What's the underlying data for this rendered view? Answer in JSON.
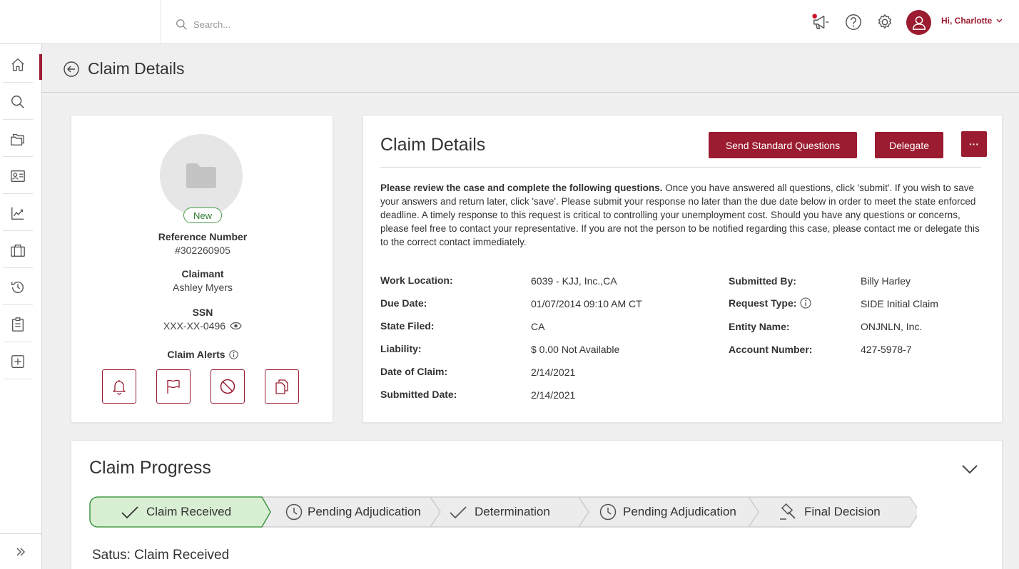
{
  "search": {
    "placeholder": "Search..."
  },
  "user": {
    "greeting": "Hi, Charlotte"
  },
  "page": {
    "title": "Claim Details"
  },
  "profile": {
    "status": "New",
    "reference_label": "Reference Number",
    "reference_value": "#302260905",
    "claimant_label": "Claimant",
    "claimant_value": "Ashley Myers",
    "ssn_label": "SSN",
    "ssn_value": "XXX-XX-0496",
    "alerts_label": "Claim Alerts"
  },
  "details": {
    "title": "Claim Details",
    "send_button": "Send Standard Questions",
    "delegate_button": "Delegate",
    "more_button": "···",
    "intro_bold": "Please review the case and complete the following questions.",
    "intro_rest": " Once you have answered all questions, click 'submit'. If you wish to save your answers and return later, click 'save'. Please submit your response no later than the due date below in order to meet the state enforced deadline. A timely response to this request is critical to controlling your unemployment cost. Should you have any questions or concerns, please feel free to contact your representative. If you are not the person to be notified regarding this case, please contact me or delegate this to the correct contact immediately.",
    "left_fields": [
      {
        "label": "Work Location:",
        "value": "6039 - KJJ, Inc.,CA"
      },
      {
        "label": "Due Date:",
        "value": "01/07/2014 09:10 AM CT"
      },
      {
        "label": "State Filed:",
        "value": "CA"
      },
      {
        "label": "Liability:",
        "value": "$ 0.00 Not Available"
      },
      {
        "label": "Date of Claim:",
        "value": "2/14/2021"
      },
      {
        "label": "Submitted Date:",
        "value": "2/14/2021"
      }
    ],
    "right_fields": [
      {
        "label": "Submitted By:",
        "value": "Billy Harley"
      },
      {
        "label": "Request Type:",
        "value": "SIDE Initial Claim"
      },
      {
        "label": "Entity Name:",
        "value": "ONJNLN, Inc."
      },
      {
        "label": "Account Number:",
        "value": "427-5978-7"
      }
    ]
  },
  "progress": {
    "title": "Claim Progress",
    "steps": [
      {
        "label": "Claim Received",
        "icon": "check-icon",
        "state": "active"
      },
      {
        "label": "Pending Adjudication",
        "icon": "clock-icon",
        "state": "pending"
      },
      {
        "label": "Determination",
        "icon": "check-icon",
        "state": "pending"
      },
      {
        "label": "Pending Adjudication",
        "icon": "clock-icon",
        "state": "pending"
      },
      {
        "label": "Final Decision",
        "icon": "gavel-icon",
        "state": "pending"
      }
    ],
    "status_text": "Satus: Claim Received"
  },
  "colors": {
    "accent": "#9b1b30",
    "success": "#4a9a4a",
    "success_bg": "#d9efd3"
  }
}
